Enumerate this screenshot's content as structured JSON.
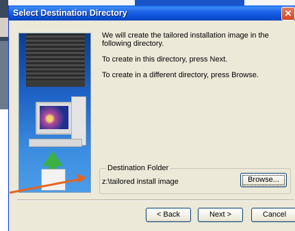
{
  "window": {
    "title": "Select Destination Directory",
    "close_glyph": "✕"
  },
  "message": {
    "line1": "We will create the tailored installation image in the following directory.",
    "line2": "To create in this directory, press Next.",
    "line3": "To create in a different directory, press Browse."
  },
  "destination": {
    "group_label": "Destination Folder",
    "path": "z:\\tailored install image",
    "browse_label": "Browse..."
  },
  "buttons": {
    "back": "< Back",
    "next": "Next >",
    "cancel": "Cancel"
  },
  "colors": {
    "dialog_bg": "#ece9d8",
    "titlebar": "#0a4fd4",
    "annotation_arrow": "#e8631c"
  },
  "icons": {
    "art": "installer-illustration",
    "close": "close-icon",
    "annotation": "annotation-arrow-icon"
  }
}
